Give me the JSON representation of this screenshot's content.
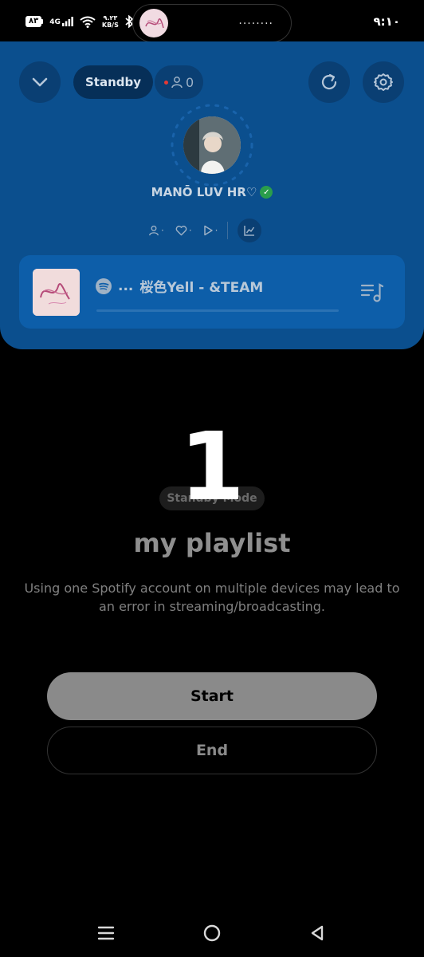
{
  "status_bar": {
    "battery": "٨٣",
    "network": "4G",
    "speed_value": "٩.٢٣",
    "speed_unit": "KB/S",
    "time": "٩:١٠",
    "pill_dots": "........"
  },
  "panel": {
    "state_label": "Standby",
    "listener_count": "0",
    "username": "MANŌ LUV HR♡",
    "stat_dot": "·",
    "now_playing": {
      "prefix": "...",
      "track": "桜色Yell - &TEAM",
      "progress": 0
    }
  },
  "main": {
    "countdown": "1",
    "mode_badge": "Standby Mode",
    "title": "my playlist",
    "warning": "Using one Spotify account on multiple devices may lead to an error in streaming/broadcasting.",
    "start_label": "Start",
    "end_label": "End"
  },
  "colors": {
    "panel_bg": "#0b4f8e",
    "card_bg": "#0d5ea9",
    "verified": "#2a9d4b",
    "live_dot": "#e53935"
  },
  "icons": [
    "battery-icon",
    "signal-icon",
    "wifi-icon",
    "bluetooth-icon",
    "chevron-down-icon",
    "user-icon",
    "refresh-icon",
    "gear-icon",
    "heart-icon",
    "play-icon",
    "chart-icon",
    "spotify-icon",
    "queue-icon",
    "menu-icon",
    "home-icon",
    "back-icon"
  ]
}
